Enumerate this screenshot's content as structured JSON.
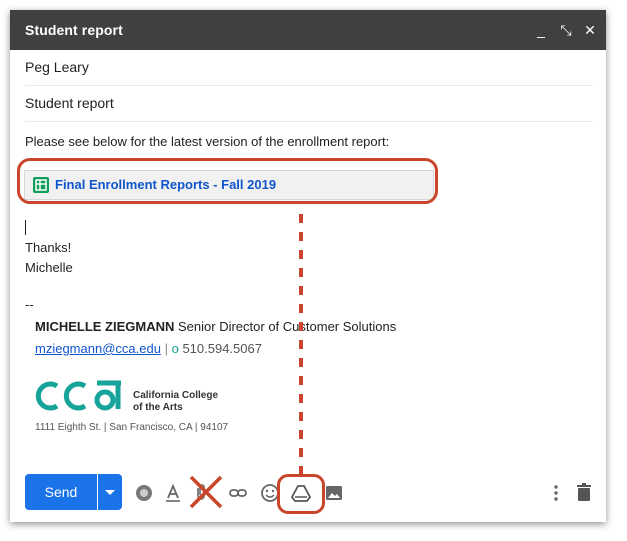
{
  "window": {
    "title": "Student report",
    "minimize_glyph": "_",
    "expand_glyph": "⤡",
    "close_glyph": "✕"
  },
  "fields": {
    "to": "Peg Leary",
    "subject": "Student report"
  },
  "message": {
    "intro": "Please see below for the latest version of the enrollment report:",
    "attachment_title": "Final Enrollment Reports - Fall 2019",
    "closing": "Thanks!",
    "name": "Michelle",
    "sig_separator": "--"
  },
  "signature": {
    "name": "MICHELLE ZIEGMANN",
    "role": "Senior Director of Customer Solutions",
    "email": "mziegmann@cca.edu",
    "sep": "|",
    "phone_prefix": "o",
    "phone": "510.594.5067",
    "logo_line1": "California College",
    "logo_line2": "of the Arts",
    "address": "1111 Eighth St. | San Francisco, CA | 94107"
  },
  "toolbar": {
    "send_label": "Send"
  },
  "colors": {
    "accent": "#1a73e8",
    "annotation": "#c9452c",
    "logo_teal": "#15a39a",
    "link": "#1155cc",
    "titlebar": "#404040"
  },
  "icons": [
    "drive-icon",
    "insert-link-icon",
    "emoji-icon",
    "photo-icon",
    "trash-icon",
    "more-options-icon",
    "format-text-icon",
    "attach-icon",
    "color-palette-icon"
  ]
}
